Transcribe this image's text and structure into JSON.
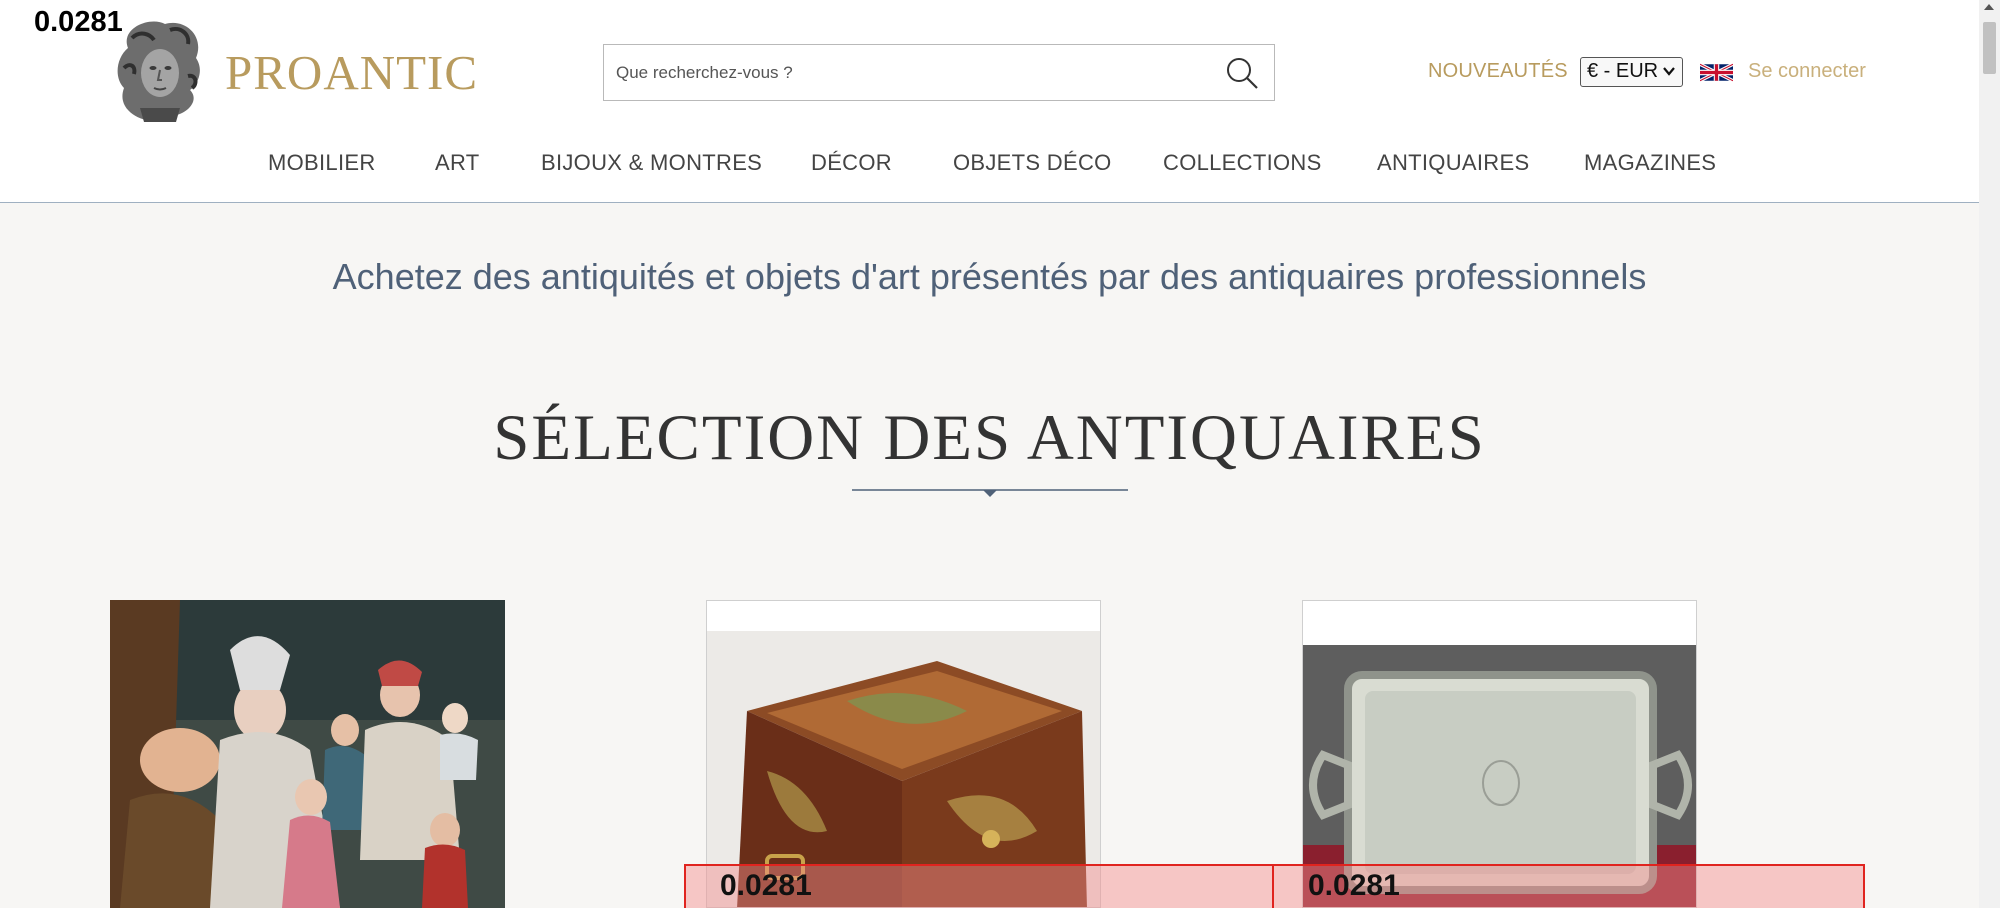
{
  "header": {
    "overlay_value": "0.0281",
    "logo_text": "PROANTIC",
    "search_placeholder": "Que recherchez-vous ?",
    "new_label": "NOUVEAUTÉS",
    "currency_value": "€ - EUR",
    "login_label": "Se connecter"
  },
  "nav": {
    "items": [
      "MOBILIER",
      "ART",
      "BIJOUX & MONTRES",
      "DÉCOR",
      "OBJETS DÉCO",
      "COLLECTIONS",
      "ANTIQUAIRES",
      "MAGAZINES"
    ]
  },
  "main": {
    "tagline": "Achetez des antiquités et objets d'art présentés par des antiquaires professionnels",
    "section_title": "SÉLECTION DES ANTIQUAIRES"
  },
  "overlays": {
    "box1_value": "0.0281",
    "box2_value": "0.0281"
  },
  "icons": {
    "search": "search-icon",
    "flag": "uk-flag-icon",
    "logo": "bust-logo"
  },
  "colors": {
    "gold": "#b89b5e",
    "tagline": "#4f6178",
    "overlay_red": "#e0241f"
  }
}
